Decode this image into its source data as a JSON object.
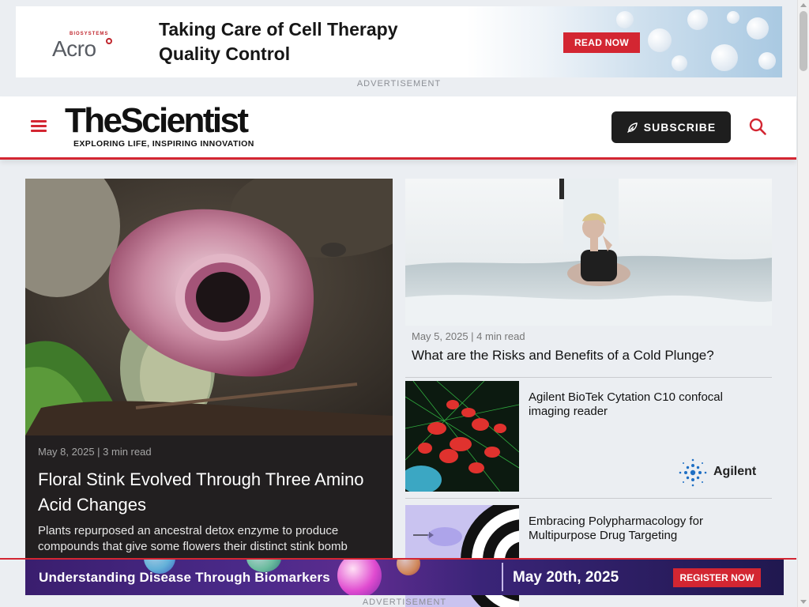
{
  "top_ad": {
    "brand_small": "BIOSYSTEMS",
    "brand": "Acro",
    "headline": "Taking Care of Cell Therapy Quality Control",
    "cta": "READ NOW",
    "label": "ADVERTISEMENT"
  },
  "header": {
    "logo_name": "TheScientist",
    "logo_tagline": "EXPLORING LIFE, INSPIRING INNOVATION",
    "subscribe_label": "SUBSCRIBE",
    "accent_color": "#d32632"
  },
  "feature": {
    "meta": "May 8, 2025 | 3 min read",
    "title": "Floral Stink Evolved Through Three Amino Acid Changes",
    "excerpt": "Plants repurposed an ancestral detox enzyme to produce compounds that give some flowers their distinct stink bomb"
  },
  "side_top": {
    "meta": "May 5, 2025 | 4 min read",
    "title": "What are the Risks and Benefits of a Cold Plunge?"
  },
  "side_cards": [
    {
      "title": "Agilent BioTek Cytation C10 confocal imaging reader",
      "sponsor": "Agilent"
    },
    {
      "title": "Embracing Polypharmacology for Multipurpose Drug Targeting"
    }
  ],
  "bottom_ad": {
    "title": "Understanding Disease Through Biomarkers",
    "date": "May 20th, 2025",
    "cta": "REGISTER NOW",
    "label": "ADVERTISEMENT"
  },
  "icons": {
    "menu": "hamburger-icon",
    "subscribe": "feather-pen-icon",
    "search": "search-icon"
  }
}
